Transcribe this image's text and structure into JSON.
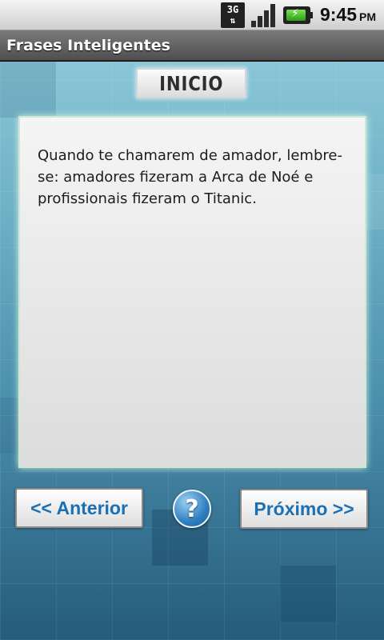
{
  "status_bar": {
    "network_label": "3G",
    "network_arrows": "⇅",
    "signal_icon": "signal-bars-icon",
    "battery_icon": "battery-charging-icon",
    "battery_bolt": "⚡",
    "time": "9:45",
    "ampm": "PM"
  },
  "app": {
    "title": "Frases Inteligentes"
  },
  "main": {
    "section_label": "INICIO",
    "quote": "Quando te chamarem de amador, lembre-se: amadores fizeram a Arca de Noé e profissionais fizeram o Titanic.",
    "prev_label": "<< Anterior",
    "help_label": "?",
    "next_label": "Próximo >>"
  },
  "colors": {
    "button_text": "#1b6fb3",
    "background_top": "#89c6d7",
    "background_bottom": "#255b7b"
  }
}
